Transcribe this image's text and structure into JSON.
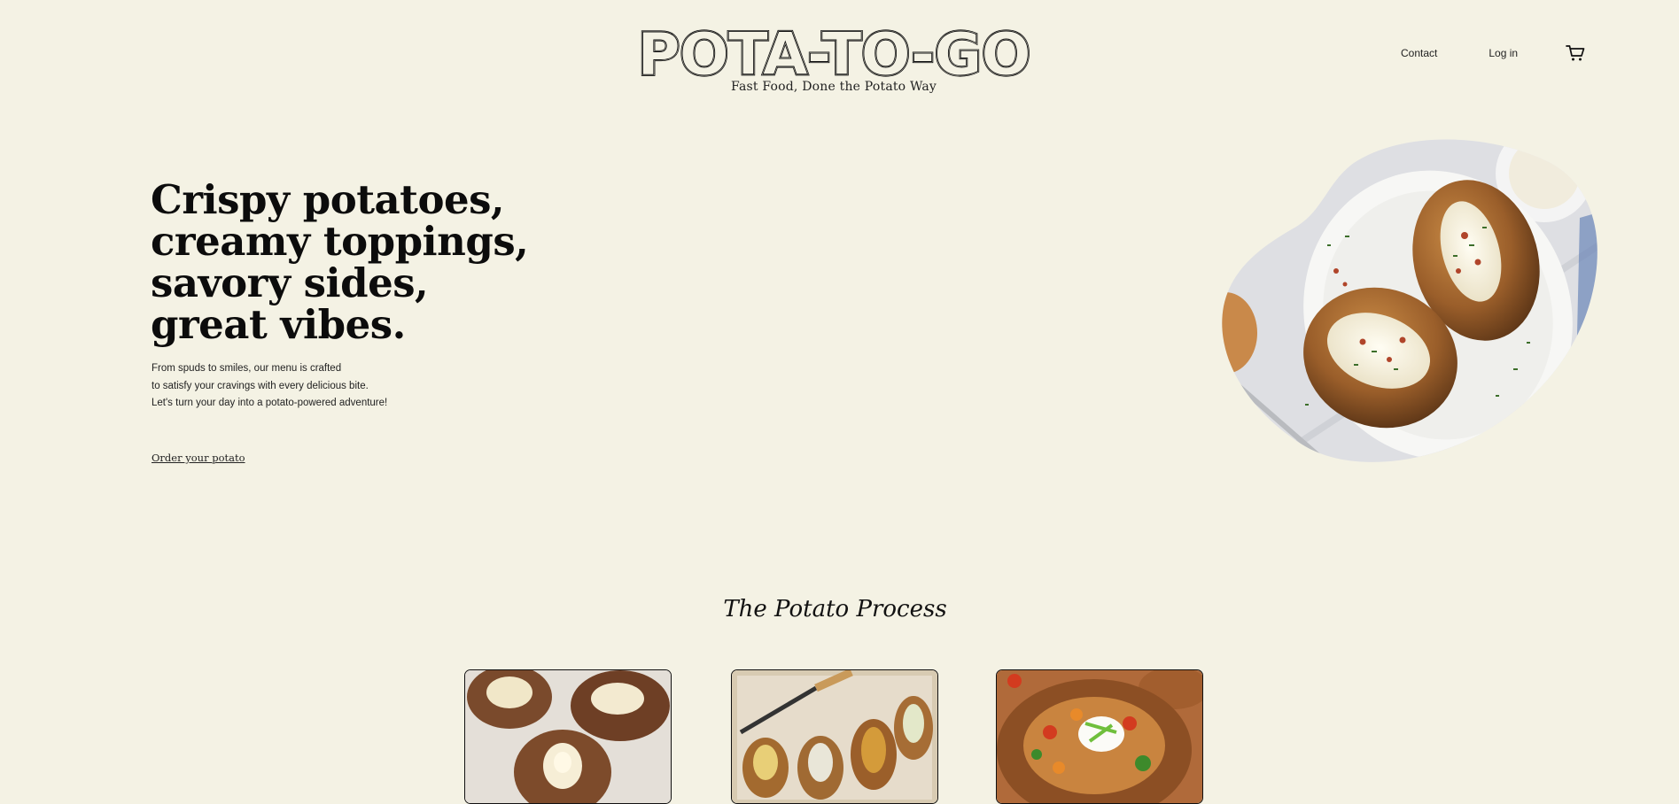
{
  "header": {
    "logo_text": "POTA-TO-GO",
    "tagline": "Fast Food, Done the Potato Way",
    "nav": {
      "contact_label": "Contact",
      "login_label": "Log in",
      "cart_icon": "cart-icon"
    }
  },
  "hero": {
    "title_lines": [
      "Crispy potatoes,",
      "creamy toppings,",
      "savory sides,",
      "great vibes."
    ],
    "description_lines": [
      "From spuds to smiles, our menu is crafted",
      "to satisfy your cravings with every delicious bite.",
      "Let's turn your day into a potato-powered adventure!"
    ],
    "cta_label": "Order your potato",
    "image_alt": "Two baked potatoes with sour cream, bacon bits and chives on a white plate"
  },
  "process": {
    "title": "The Potato Process",
    "cards": [
      {
        "image_alt": "Baked potatoes split open with butter"
      },
      {
        "image_alt": "Stuffed potato skins on a baking tray with a knife"
      },
      {
        "image_alt": "Loaded baked potato with vegetables and sour cream"
      }
    ]
  },
  "colors": {
    "background": "#f4f2e4",
    "text": "#111111",
    "card_border": "#111111"
  }
}
